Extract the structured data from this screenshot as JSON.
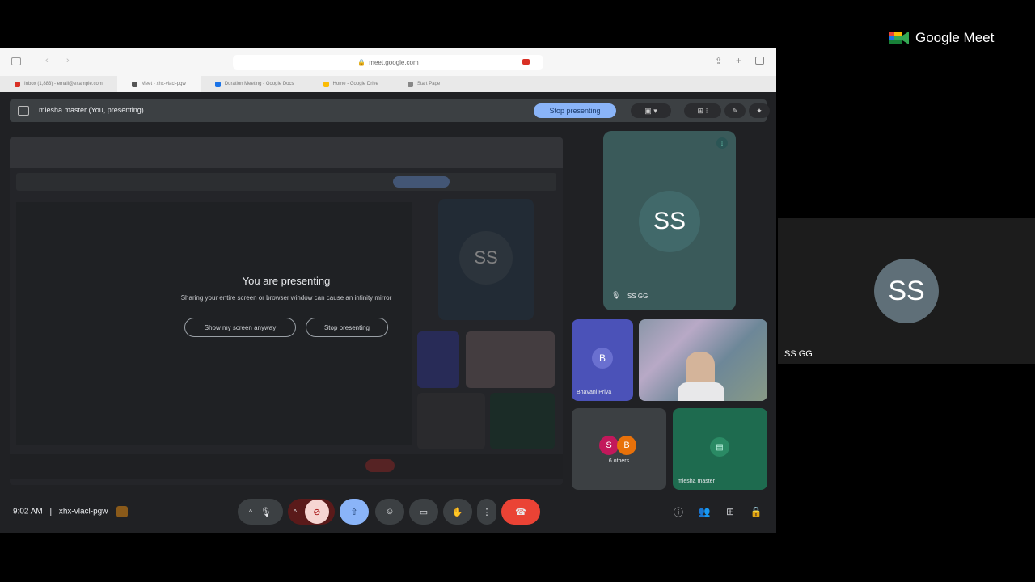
{
  "browser": {
    "url": "meet.google.com",
    "tabs": [
      {
        "label": "Inbox (1,883) - email@example.com",
        "color": "#d93025"
      },
      {
        "label": "Meet - xhx-vlacl-pgw",
        "color": "#555"
      },
      {
        "label": "Duration Meeting - Google Docs",
        "color": "#1a73e8"
      },
      {
        "label": "Home - Google Drive",
        "color": "#fbbc04"
      },
      {
        "label": "Start Page",
        "color": "#888"
      }
    ]
  },
  "presentation_bar": {
    "title": "mlesha master (You, presenting)",
    "stop_label": "Stop presenting"
  },
  "shared_screen": {
    "title": "You are presenting",
    "subtitle": "Sharing your entire screen or browser window can cause an infinity mirror",
    "show_anyway_label": "Show my screen anyway",
    "stop_label": "Stop presenting",
    "ghost_avatar": "SS"
  },
  "participants": {
    "big_tile": {
      "initials": "SS",
      "name": "SS GG"
    },
    "b_tile": {
      "initial": "B",
      "name": "Bhavani Priya"
    },
    "others_tile": {
      "label": "6 others",
      "chip1": "S",
      "chip2": "B"
    },
    "green_tile": {
      "name": "mlesha master"
    }
  },
  "bottom_bar": {
    "time": "9:02 AM",
    "separator": "|",
    "meeting_code": "xhx-vlacl-pgw"
  },
  "right_panel": {
    "brand": "Google Meet",
    "tile_initials": "SS",
    "tile_name": "SS GG"
  },
  "colors": {
    "stop_button": "#8ab4f8",
    "end_call": "#ea4335",
    "present_active": "#8ab4f8"
  }
}
